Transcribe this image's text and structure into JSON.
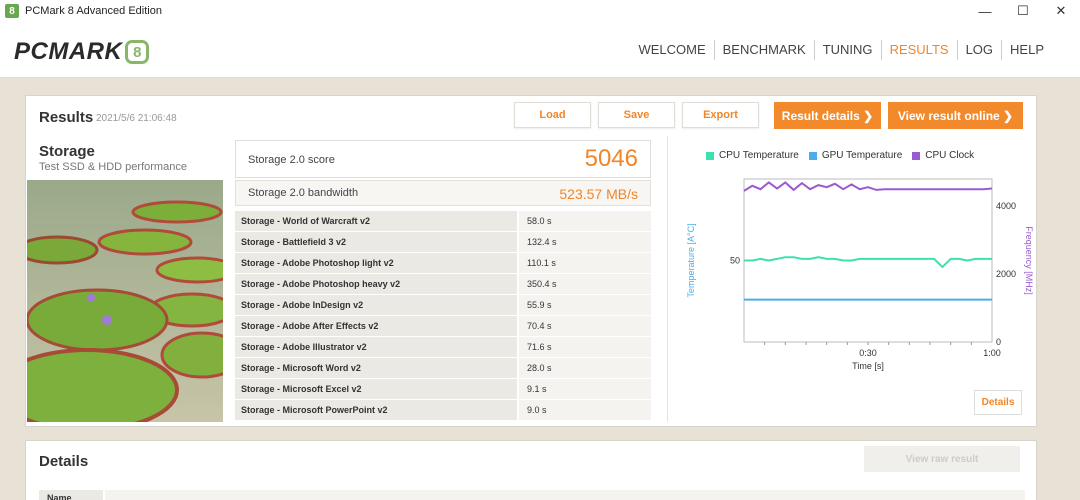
{
  "window": {
    "title": "PCMark 8 Advanced Edition",
    "icon_glyph": "8",
    "controls": [
      "—",
      "☐",
      "✕"
    ]
  },
  "header": {
    "logo_text": "PCMARK",
    "logo_badge": "8",
    "nav": [
      {
        "label": "WELCOME",
        "active": false
      },
      {
        "label": "BENCHMARK",
        "active": false
      },
      {
        "label": "TUNING",
        "active": false
      },
      {
        "label": "RESULTS",
        "active": true
      },
      {
        "label": "LOG",
        "active": false
      },
      {
        "label": "HELP",
        "active": false
      }
    ]
  },
  "results": {
    "title": "Results",
    "date": "2021/5/6 21:06:48",
    "buttons": {
      "load": "Load",
      "save": "Save",
      "export": "Export",
      "result_details": "Result details  ❯",
      "view_online": "View result online  ❯"
    },
    "storage": {
      "name": "Storage",
      "description": "Test SSD & HDD performance"
    },
    "score_label": "Storage 2.0 score",
    "score_value": "5046",
    "bandwidth_label": "Storage 2.0 bandwidth",
    "bandwidth_value": "523.57 MB/s",
    "tests": [
      {
        "name": "Storage - World of Warcraft v2",
        "value": "58.0 s"
      },
      {
        "name": "Storage - Battlefield 3 v2",
        "value": "132.4 s"
      },
      {
        "name": "Storage - Adobe Photoshop light v2",
        "value": "110.1 s"
      },
      {
        "name": "Storage - Adobe Photoshop heavy v2",
        "value": "350.4 s"
      },
      {
        "name": "Storage - Adobe InDesign v2",
        "value": "55.9 s"
      },
      {
        "name": "Storage - Adobe After Effects v2",
        "value": "70.4 s"
      },
      {
        "name": "Storage - Adobe Illustrator v2",
        "value": "71.6 s"
      },
      {
        "name": "Storage - Microsoft Word v2",
        "value": "28.0 s"
      },
      {
        "name": "Storage - Microsoft Excel v2",
        "value": "9.1 s"
      },
      {
        "name": "Storage - Microsoft PowerPoint v2",
        "value": "9.0 s"
      }
    ],
    "monitor": {
      "legend": [
        {
          "label": "CPU Temperature",
          "color": "#3fe0b0"
        },
        {
          "label": "GPU Temperature",
          "color": "#4aaee8"
        },
        {
          "label": "CPU Clock",
          "color": "#9a5ad0"
        }
      ],
      "details_button": "Details"
    }
  },
  "chart_data": {
    "type": "line",
    "xlabel": "Time [s]",
    "ylabel_left": "Temperature [A°C]",
    "ylabel_right": "Frequency [MHz]",
    "x_ticks": [
      "0:30",
      "1:00"
    ],
    "y_left_ticks": [
      "50"
    ],
    "y_right_ticks": [
      "4000",
      "2000",
      "0"
    ],
    "xlim": [
      0,
      60
    ],
    "ylim_left": [
      0,
      100
    ],
    "ylim_right": [
      0,
      4800
    ],
    "series": [
      {
        "name": "CPU Temperature",
        "axis": "left",
        "x": [
          0,
          2,
          4,
          6,
          8,
          10,
          12,
          14,
          16,
          18,
          20,
          22,
          24,
          26,
          28,
          30,
          32,
          34,
          36,
          38,
          40,
          42,
          44,
          46,
          48,
          50,
          52,
          54,
          56,
          58,
          60
        ],
        "y": [
          50,
          50,
          51,
          50,
          51,
          52,
          52,
          51,
          51,
          52,
          51,
          51,
          50,
          50,
          51,
          51,
          51,
          51,
          51,
          51,
          51,
          51,
          51,
          51,
          46,
          51,
          51,
          50,
          51,
          51,
          51
        ]
      },
      {
        "name": "GPU Temperature",
        "axis": "left",
        "x": [
          0,
          10,
          20,
          30,
          40,
          50,
          60
        ],
        "y": [
          26,
          26,
          26,
          26,
          26,
          26,
          26
        ]
      },
      {
        "name": "CPU Clock",
        "axis": "right",
        "x": [
          0,
          2,
          4,
          6,
          8,
          10,
          12,
          14,
          16,
          18,
          20,
          22,
          24,
          26,
          28,
          30,
          32,
          34,
          36,
          38,
          40,
          42,
          44,
          46,
          48,
          50,
          52,
          54,
          56,
          58,
          60
        ],
        "y": [
          4450,
          4600,
          4500,
          4700,
          4520,
          4700,
          4480,
          4680,
          4500,
          4620,
          4560,
          4660,
          4500,
          4640,
          4500,
          4560,
          4480,
          4500,
          4500,
          4500,
          4500,
          4500,
          4500,
          4500,
          4500,
          4500,
          4500,
          4500,
          4500,
          4500,
          4520
        ]
      }
    ]
  },
  "details": {
    "title": "Details",
    "view_raw": "View raw result",
    "name_header": "Name"
  }
}
